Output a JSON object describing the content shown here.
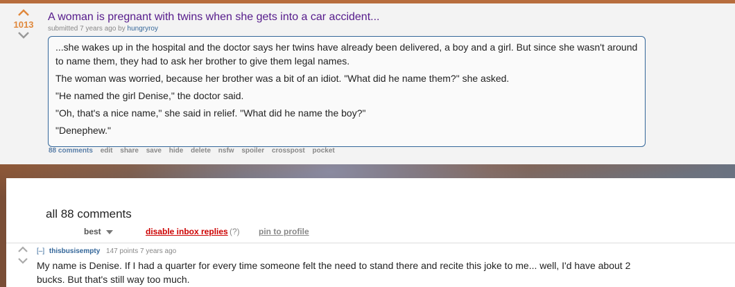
{
  "post": {
    "score": "1013",
    "title": "A woman is pregnant with twins when she gets into a car accident...",
    "tagline_prefix": "submitted 7 years ago by",
    "author": "hungryroy",
    "selftext": [
      "...she wakes up in the hospital and the doctor says her twins have already been delivered, a boy and a girl. But since she wasn't around to name them, they had to ask her brother to give them legal names.",
      "The woman was worried, because her brother was a bit of an idiot. \"What did he name them?\" she asked.",
      "\"He named the girl Denise,\" the doctor said.",
      "\"Oh, that's a nice name,\" she said in relief. \"What did he name the boy?\"",
      "\"Denephew.\""
    ],
    "buttons": {
      "comments": "88 comments",
      "edit": "edit",
      "share": "share",
      "save": "save",
      "hide": "hide",
      "delete": "delete",
      "nsfw": "nsfw",
      "spoiler": "spoiler",
      "crosspost": "crosspost",
      "pocket": "pocket"
    }
  },
  "comments_panel": {
    "heading": "all 88 comments",
    "sort_label": "best",
    "disable_inbox": "disable inbox replies",
    "help": "(?)",
    "pin": "pin to profile"
  },
  "comment": {
    "toggle": "[–]",
    "author": "thisbusisempty",
    "meta": "147 points 7 years ago",
    "body": "My name is Denise. If I had a quarter for every time someone felt the need to stand there and recite this joke to me... well, I'd have about 2 bucks. But that's still way too much."
  },
  "colors": {
    "upvote": "#e0883c",
    "title": "#551a8b",
    "link": "#336699",
    "disable": "#cc0000"
  }
}
